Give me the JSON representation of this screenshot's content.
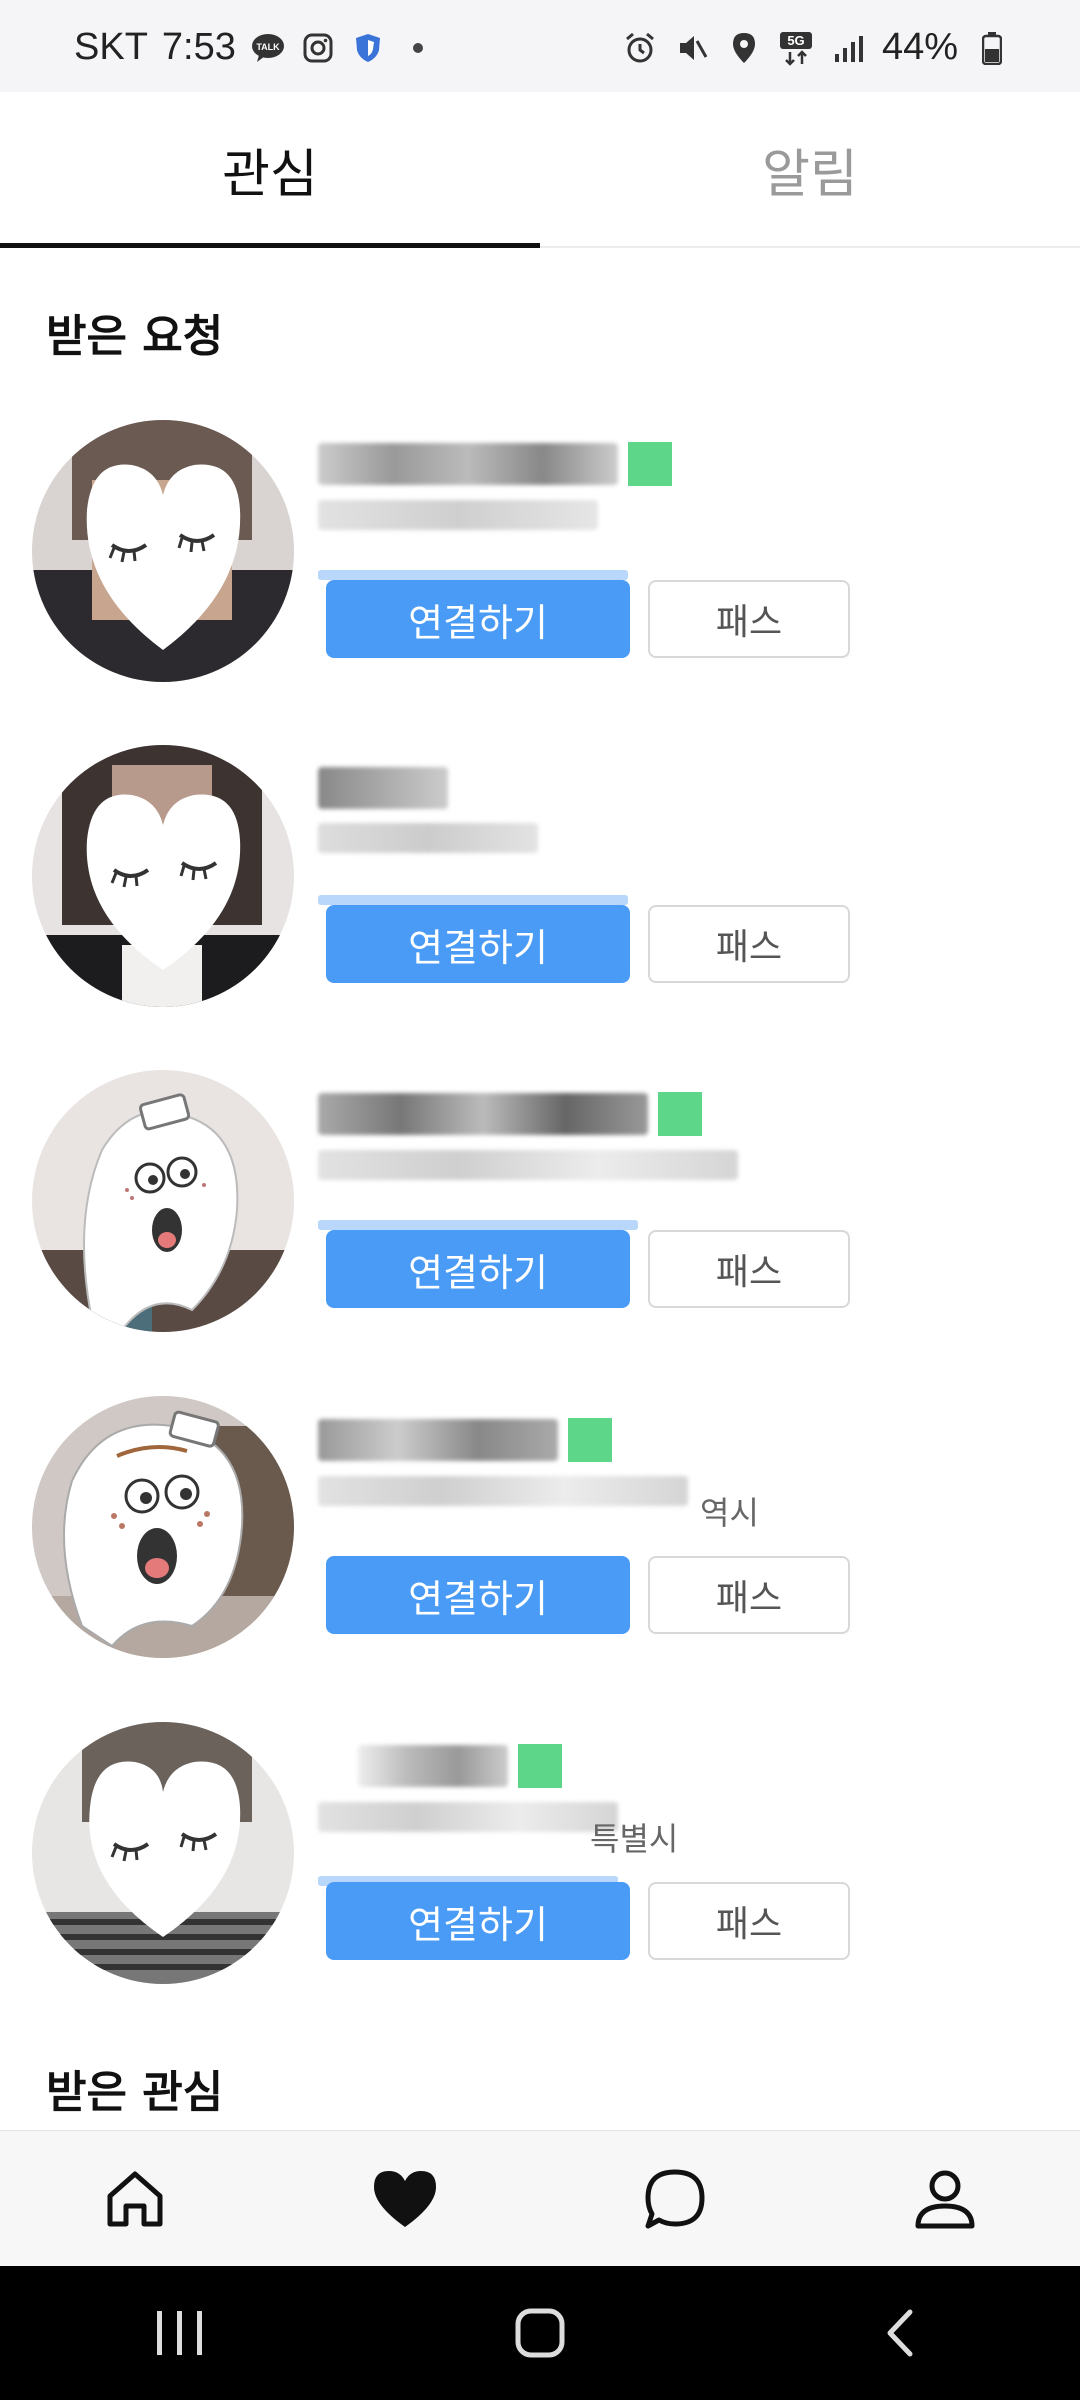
{
  "status_bar": {
    "carrier": "SKT",
    "time": "7:53",
    "talk_label": "TALK",
    "network": "5G",
    "battery": "44%"
  },
  "tabs": [
    {
      "label": "관심",
      "active": true
    },
    {
      "label": "알림",
      "active": false
    }
  ],
  "sections": {
    "received_requests": "받은 요청",
    "received_interest": "받은 관심"
  },
  "requests": [
    {
      "connect_label": "연결하기",
      "pass_label": "패스",
      "location_suffix": "",
      "online": true
    },
    {
      "connect_label": "연결하기",
      "pass_label": "패스",
      "location_suffix": "",
      "online": false
    },
    {
      "connect_label": "연결하기",
      "pass_label": "패스",
      "location_suffix": "",
      "online": true
    },
    {
      "connect_label": "연결하기",
      "pass_label": "패스",
      "location_suffix": "역시",
      "online": true
    },
    {
      "connect_label": "연결하기",
      "pass_label": "패스",
      "location_suffix": "특별시",
      "online": true
    }
  ],
  "bottom_nav": [
    {
      "icon": "home-icon"
    },
    {
      "icon": "heart-icon",
      "active": true
    },
    {
      "icon": "chat-icon"
    },
    {
      "icon": "profile-icon"
    }
  ],
  "colors": {
    "accent": "#4a9bf6",
    "online": "#3ecf6e"
  }
}
